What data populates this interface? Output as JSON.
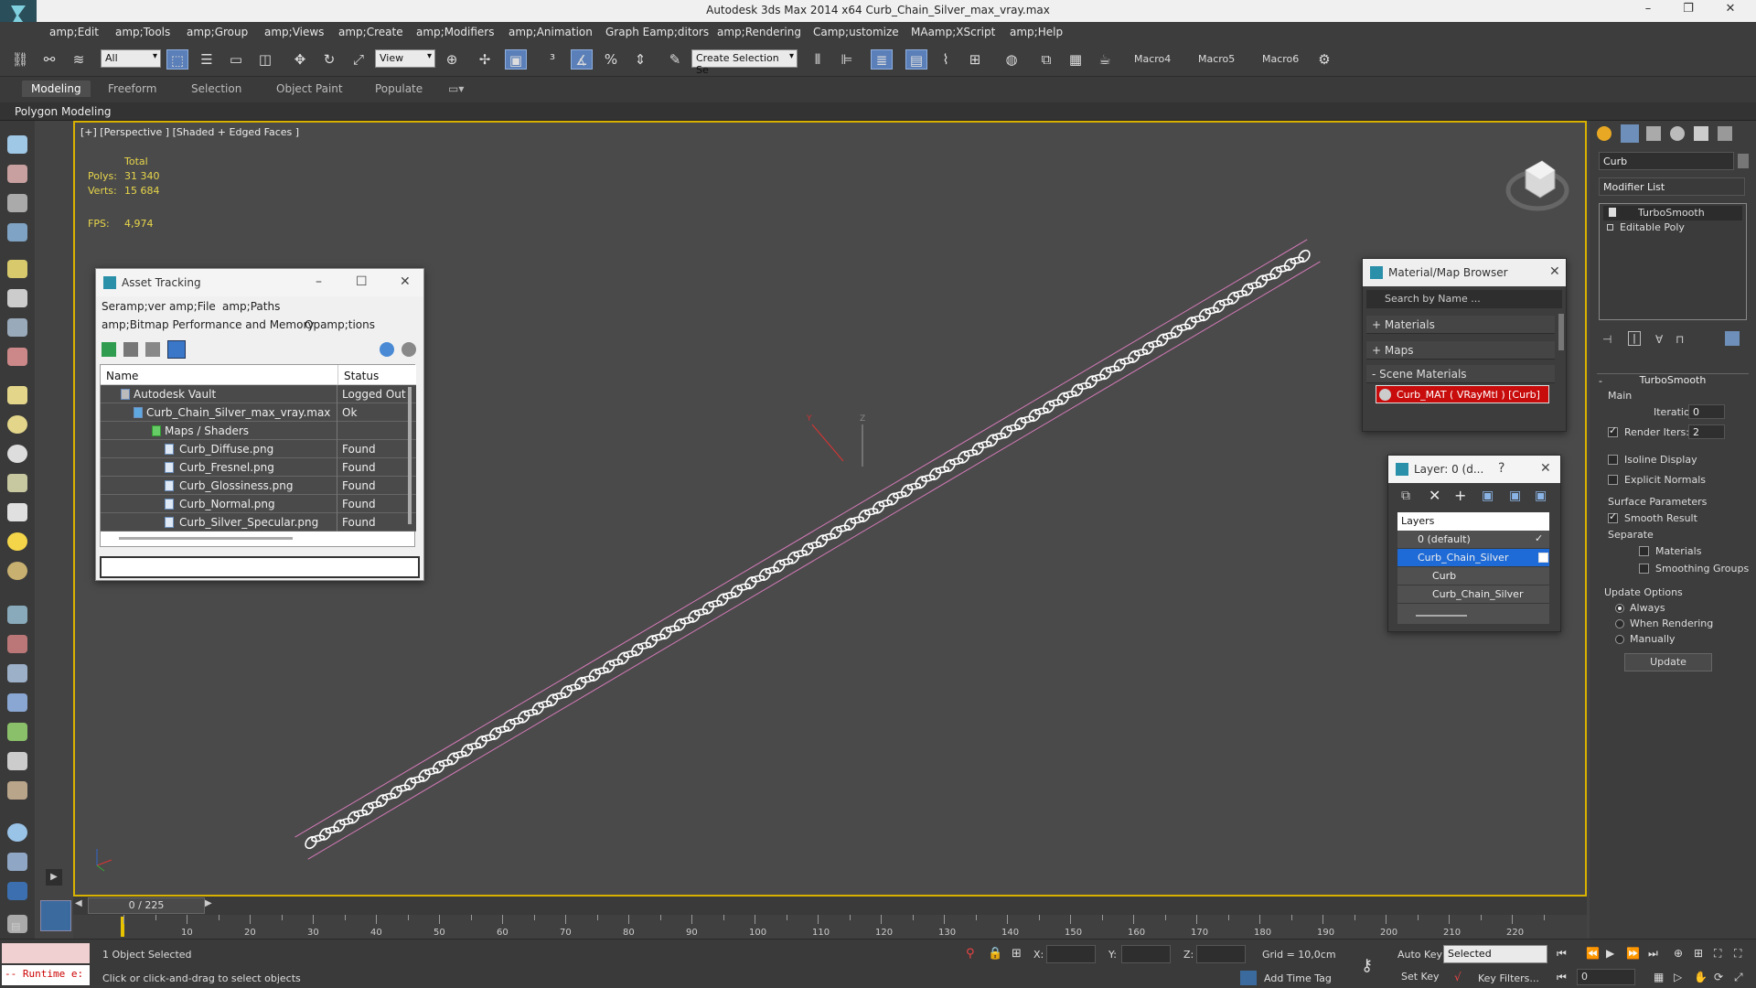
{
  "window": {
    "title": "Autodesk 3ds Max  2014 x64     Curb_Chain_Silver_max_vray.max"
  },
  "menu": [
    "amp;Edit",
    "amp;Tools",
    "amp;Group",
    "amp;Views",
    "amp;Create",
    "amp;Modifiers",
    "amp;Animation",
    "Graph Eamp;ditors",
    "amp;Rendering",
    "Camp;ustomize",
    "MAamp;XScript",
    "amp;Help"
  ],
  "toolbar": {
    "selection_filter": "All",
    "ref_coord": "View",
    "named_selection": "Create Selection Se",
    "macros": [
      "Macro4",
      "Macro5",
      "Macro6"
    ]
  },
  "ribbon": {
    "tabs": [
      "Modeling",
      "Freeform",
      "Selection",
      "Object Paint",
      "Populate"
    ],
    "panel": "Polygon Modeling"
  },
  "viewport": {
    "label": "[+] [Perspective ] [Shaded + Edged Faces ]",
    "stats": {
      "header": "Total",
      "polys_label": "Polys:",
      "polys": "31 340",
      "verts_label": "Verts:",
      "verts": "15 684",
      "fps_label": "FPS:",
      "fps": "4,974"
    }
  },
  "asset_tracking": {
    "title": "Asset Tracking",
    "menu": [
      "Seramp;ver",
      "amp;File",
      "amp;Paths",
      "amp;Bitmap Performance and Memory",
      "Opamp;tions"
    ],
    "columns": [
      "Name",
      "Status"
    ],
    "rows": [
      {
        "name": "Autodesk Vault",
        "status": "Logged Out ..."
      },
      {
        "name": "Curb_Chain_Silver_max_vray.max",
        "status": "Ok"
      },
      {
        "name": "Maps / Shaders",
        "status": ""
      },
      {
        "name": "Curb_Diffuse.png",
        "status": "Found"
      },
      {
        "name": "Curb_Fresnel.png",
        "status": "Found"
      },
      {
        "name": "Curb_Glossiness.png",
        "status": "Found"
      },
      {
        "name": "Curb_Normal.png",
        "status": "Found"
      },
      {
        "name": "Curb_Silver_Specular.png",
        "status": "Found"
      }
    ]
  },
  "material_browser": {
    "title": "Material/Map Browser",
    "search_placeholder": "Search by Name ...",
    "sections": [
      "+ Materials",
      "+ Maps",
      "- Scene Materials"
    ],
    "scene_material": "Curb_MAT  ( VRayMtl )  [Curb]"
  },
  "layer_dialog": {
    "title": "Layer: 0 (d...",
    "help": "?",
    "header": "Layers",
    "rows": [
      "0 (default)",
      "Curb_Chain_Silver",
      "Curb",
      "Curb_Chain_Silver"
    ]
  },
  "command_panel": {
    "object_name": "Curb",
    "modifier_list": "Modifier List",
    "stack": [
      "TurboSmooth",
      "Editable Poly"
    ],
    "rollout_title": "TurboSmooth",
    "main_group": "Main",
    "iterations_label": "Iterations:",
    "iterations": "0",
    "render_iters_label": "Render Iters:",
    "render_iters": "2",
    "render_iters_checked": true,
    "isoline": "Isoline Display",
    "explicit_normals": "Explicit Normals",
    "surface_params": "Surface Parameters",
    "smooth_result": "Smooth Result",
    "separate": "Separate",
    "materials": "Materials",
    "smoothing_groups": "Smoothing Groups",
    "update_options": "Update Options",
    "always": "Always",
    "when_rendering": "When Rendering",
    "manually": "Manually",
    "update_btn": "Update"
  },
  "timeline": {
    "frame_display": "0 / 225",
    "ticks": [
      "10",
      "20",
      "30",
      "40",
      "50",
      "60",
      "70",
      "80",
      "90",
      "100",
      "110",
      "120",
      "130",
      "140",
      "150",
      "160",
      "170",
      "180",
      "190",
      "200",
      "210",
      "220"
    ]
  },
  "status": {
    "maxscript": "-- Runtime e:",
    "selected_count": "1 Object Selected",
    "prompt": "Click or click-and-drag to select objects",
    "x_label": "X:",
    "y_label": "Y:",
    "z_label": "Z:",
    "grid": "Grid = 10,0cm",
    "add_time_tag": "Add Time Tag",
    "auto_key": "Auto Key",
    "set_key": "Set Key",
    "key_mode": "Selected",
    "key_filters": "Key Filters...",
    "current_frame": "0"
  }
}
